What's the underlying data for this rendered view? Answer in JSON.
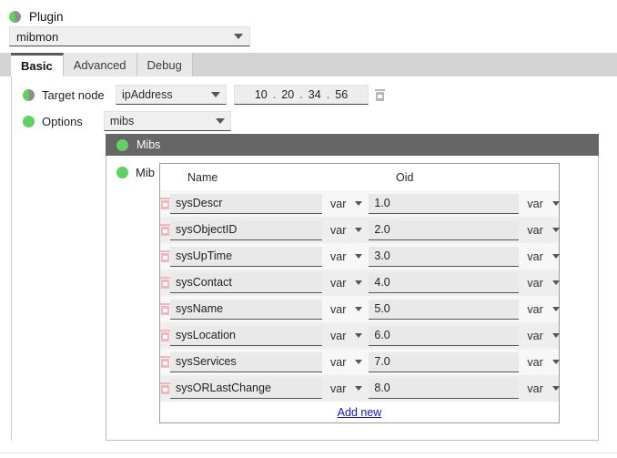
{
  "plugin": {
    "label": "Plugin",
    "status_icon": "half-filled-green-circle",
    "selected": "mibmon",
    "dropdown_icon": "chevron-down-icon"
  },
  "tabs": [
    {
      "label": "Basic",
      "active": true
    },
    {
      "label": "Advanced",
      "active": false
    },
    {
      "label": "Debug",
      "active": false
    }
  ],
  "fields": {
    "target_node": {
      "label": "Target node",
      "status_icon": "half-filled-green-circle",
      "type_selected": "ipAddress",
      "ip": {
        "octets": [
          "10",
          "20",
          "34",
          "56"
        ],
        "separator": "."
      },
      "clear_icon": "trash-icon"
    },
    "options": {
      "label": "Options",
      "status_icon": "green-circle",
      "selected": "mibs"
    }
  },
  "mibs": {
    "header_label": "Mibs",
    "header_icon": "green-circle",
    "mib_label": "Mib",
    "mib_icon": "green-circle",
    "columns": [
      "Name",
      "Oid"
    ],
    "rows": [
      {
        "name": "sysDescr",
        "name_type": "var",
        "oid": "1.0",
        "oid_type": "var",
        "delete_icon": "trash-icon"
      },
      {
        "name": "sysObjectID",
        "name_type": "var",
        "oid": "2.0",
        "oid_type": "var",
        "delete_icon": "trash-icon"
      },
      {
        "name": "sysUpTime",
        "name_type": "var",
        "oid": "3.0",
        "oid_type": "var",
        "delete_icon": "trash-icon"
      },
      {
        "name": "sysContact",
        "name_type": "var",
        "oid": "4.0",
        "oid_type": "var",
        "delete_icon": "trash-icon"
      },
      {
        "name": "sysName",
        "name_type": "var",
        "oid": "5.0",
        "oid_type": "var",
        "delete_icon": "trash-icon"
      },
      {
        "name": "sysLocation",
        "name_type": "var",
        "oid": "6.0",
        "oid_type": "var",
        "delete_icon": "trash-icon"
      },
      {
        "name": "sysServices",
        "name_type": "var",
        "oid": "7.0",
        "oid_type": "var",
        "delete_icon": "trash-icon"
      },
      {
        "name": "sysORLastChange",
        "name_type": "var",
        "oid": "8.0",
        "oid_type": "var",
        "delete_icon": "trash-icon"
      }
    ],
    "add_new_label": "Add new"
  },
  "colors": {
    "status_green": "#5ed15e",
    "group_header_bg": "#666666",
    "tabbar_bg": "#d4d4d4",
    "link_blue": "#1414cf",
    "delete_icon": "#f3b6be"
  }
}
